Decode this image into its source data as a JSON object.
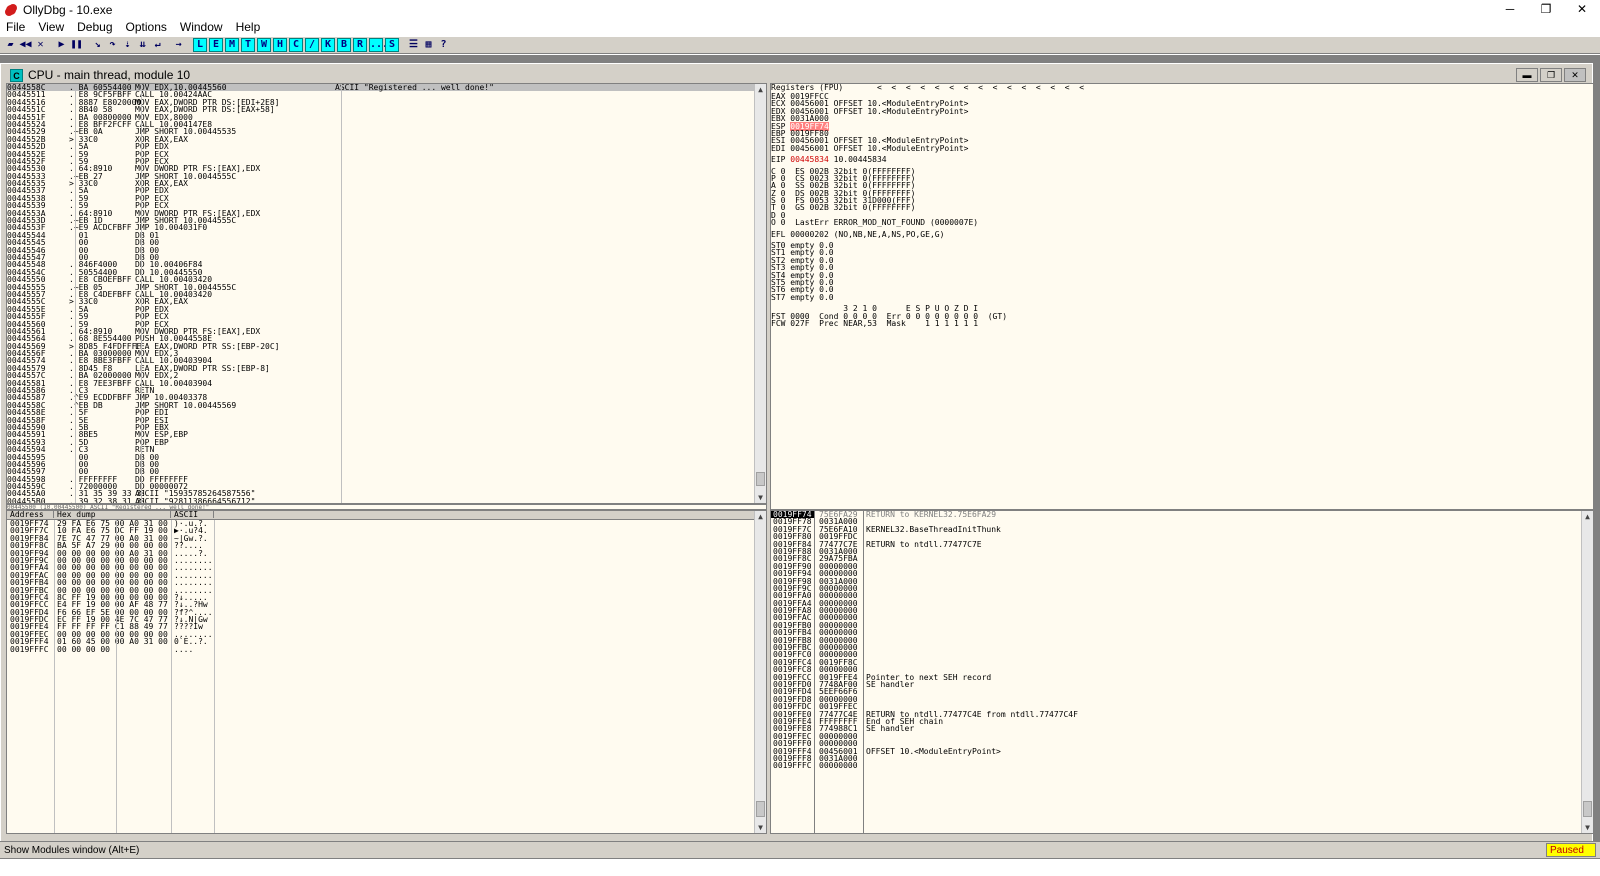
{
  "window": {
    "title": "OllyDbg - 10.exe",
    "min": "─",
    "restore": "❐",
    "close": "✕"
  },
  "menu": [
    "File",
    "View",
    "Debug",
    "Options",
    "Window",
    "Help"
  ],
  "toolbar": {
    "icons": [
      "open-icon",
      "restart-icon",
      "close-debug-icon",
      "run-icon",
      "pause-icon",
      "step-into-icon",
      "step-over-icon",
      "trace-into-icon",
      "trace-over-icon",
      "execute-till-return-icon",
      "goto-icon"
    ],
    "letters": [
      "L",
      "E",
      "M",
      "T",
      "W",
      "H",
      "C",
      "/",
      "K",
      "B",
      "R",
      "...",
      "S"
    ],
    "tail_icons": [
      "list-icon",
      "grid-icon",
      "help-icon"
    ]
  },
  "cpu_window": {
    "title": "CPU - main thread, module 10",
    "icon": "C"
  },
  "disasm": {
    "rows": [
      [
        "0044558C",
        ". BA 60554400",
        "MOV EDX,10.00445560",
        "ASCII \"Registered ... well done!\""
      ],
      [
        "00445511",
        ". E8 9CF5FBFF",
        "CALL 10.00424AAC",
        ""
      ],
      [
        "00445516",
        ". 8887 E8020000",
        "MOV EAX,DWORD PTR DS:[EDI+2E8]",
        ""
      ],
      [
        "0044551C",
        ". 8B40 58",
        "MOV EAX,DWORD PTR DS:[EAX+58]",
        ""
      ],
      [
        "0044551F",
        ". BA 00800000",
        "MOV EDX,8000",
        ""
      ],
      [
        "00445524",
        ". E8 BFF2FCFF",
        "CALL 10.004147E8",
        ""
      ],
      [
        "00445529",
        ".~EB 0A",
        "JMP SHORT 10.00445535",
        ""
      ],
      [
        "0044552B",
        "> 33C0",
        "XOR EAX,EAX",
        ""
      ],
      [
        "0044552D",
        ". 5A",
        "POP EDX",
        ""
      ],
      [
        "0044552E",
        ". 59",
        "POP ECX",
        ""
      ],
      [
        "0044552F",
        ". 59",
        "POP ECX",
        ""
      ],
      [
        "00445530",
        ". 64:8910",
        "MOV DWORD PTR FS:[EAX],EDX",
        ""
      ],
      [
        "00445533",
        ".~EB 27",
        "JMP SHORT 10.0044555C",
        ""
      ],
      [
        "00445535",
        "> 33C0",
        "XOR EAX,EAX",
        ""
      ],
      [
        "00445537",
        ". 5A",
        "POP EDX",
        ""
      ],
      [
        "00445538",
        ". 59",
        "POP ECX",
        ""
      ],
      [
        "00445539",
        ". 59",
        "POP ECX",
        ""
      ],
      [
        "0044553A",
        ". 64:8910",
        "MOV DWORD PTR FS:[EAX],EDX",
        ""
      ],
      [
        "0044553D",
        ".~EB 1D",
        "JMP SHORT 10.0044555C",
        ""
      ],
      [
        "0044553F",
        ".~E9 ACDCFBFF",
        "JMP 10.004031F0",
        ""
      ],
      [
        "00445544",
        "  01",
        "DB 01",
        ""
      ],
      [
        "00445545",
        "  00",
        "DB 00",
        ""
      ],
      [
        "00445546",
        "  00",
        "DB 00",
        ""
      ],
      [
        "00445547",
        "  00",
        "DB 00",
        ""
      ],
      [
        "00445548",
        ". 846F4000",
        "DD 10.00406F84",
        ""
      ],
      [
        "0044554C",
        ". 50554400",
        "DD 10.00445550",
        ""
      ],
      [
        "00445550",
        ". E8 CBOEFBFF",
        "CALL 10.00403420",
        ""
      ],
      [
        "00445555",
        ".~EB 05",
        "JMP SHORT 10.0044555C",
        ""
      ],
      [
        "00445557",
        ". E8 C4DEFBFF",
        "CALL 10.00403420",
        ""
      ],
      [
        "0044555C",
        "> 33C0",
        "XOR EAX,EAX",
        ""
      ],
      [
        "0044555E",
        ". 5A",
        "POP EDX",
        ""
      ],
      [
        "0044555F",
        ". 59",
        "POP ECX",
        ""
      ],
      [
        "00445560",
        ". 59",
        "POP ECX",
        ""
      ],
      [
        "00445561",
        ". 64:8910",
        "MOV DWORD PTR FS:[EAX],EDX",
        ""
      ],
      [
        "00445564",
        ". 68 8E554400",
        "PUSH 10.0044558E",
        ""
      ],
      [
        "00445569",
        "> 8D85 F4FDFFFF",
        "LEA EAX,DWORD PTR SS:[EBP-20C]",
        ""
      ],
      [
        "0044556F",
        ". BA 03000000",
        "MOV EDX,3",
        ""
      ],
      [
        "00445574",
        ". E8 8BE3FBFF",
        "CALL 10.00403904",
        ""
      ],
      [
        "00445579",
        ". 8D45 F8",
        "LEA EAX,DWORD PTR SS:[EBP-8]",
        ""
      ],
      [
        "0044557C",
        ". BA 02000000",
        "MOV EDX,2",
        ""
      ],
      [
        "00445581",
        ". E8 7EE3FBFF",
        "CALL 10.00403904",
        ""
      ],
      [
        "00445586",
        ". C3",
        "RETN",
        ""
      ],
      [
        "00445587",
        ".^E9 ECDDFBFF",
        "JMP 10.00403378",
        ""
      ],
      [
        "0044558C",
        ".^EB DB",
        "JMP SHORT 10.00445569",
        ""
      ],
      [
        "0044558E",
        ". 5F",
        "POP EDI",
        ""
      ],
      [
        "0044558F",
        ". 5E",
        "POP ESI",
        ""
      ],
      [
        "00445590",
        ". 5B",
        "POP EBX",
        ""
      ],
      [
        "00445591",
        ". 8BE5",
        "MOV ESP,EBP",
        ""
      ],
      [
        "00445593",
        ". 5D",
        "POP EBP",
        ""
      ],
      [
        "00445594",
        ". C3",
        "RETN",
        ""
      ],
      [
        "00445595",
        "  00",
        "DB 00",
        ""
      ],
      [
        "00445596",
        "  00",
        "DB 00",
        ""
      ],
      [
        "00445597",
        "  00",
        "DB 00",
        ""
      ],
      [
        "00445598",
        ". FFFFFFFF",
        "DD FFFFFFFF",
        ""
      ],
      [
        "0044559C",
        ". 72000000",
        "DD 00000072",
        ""
      ],
      [
        "004455A0",
        ". 31 35 39 33 3!",
        "ASCII \"15935785264587556\"",
        ""
      ],
      [
        "004455B0",
        ". 39 32 38 31 3!",
        "ASCII \"92811386664556712\"",
        ""
      ]
    ]
  },
  "infoline": "00445500 (10.00445500) ASCII \"Registered ... well done!\"",
  "registers": {
    "header": "Registers (FPU)",
    "arrows": "<  <  <  <  <  <  <  <  <  <  <  <  <  <  <",
    "general": [
      [
        "EAX",
        "0019FFCC",
        ""
      ],
      [
        "ECX",
        "00456001",
        "OFFSET 10.<ModuleEntryPoint>"
      ],
      [
        "EDX",
        "00456001",
        "OFFSET 10.<ModuleEntryPoint>"
      ],
      [
        "EBX",
        "0031A000",
        ""
      ],
      [
        "ESP",
        "0019FF74",
        ""
      ],
      [
        "EBP",
        "0019FF80",
        ""
      ],
      [
        "ESI",
        "00456001",
        "OFFSET 10.<ModuleEntryPoint>"
      ],
      [
        "EDI",
        "00456001",
        "OFFSET 10.<ModuleEntryPoint>"
      ]
    ],
    "eip": [
      "EIP",
      "00445834",
      "10.00445834"
    ],
    "flags": [
      "C 0  ES 002B 32bit 0(FFFFFFFF)",
      "P 0  CS 0023 32bit 0(FFFFFFFF)",
      "A 0  SS 002B 32bit 0(FFFFFFFF)",
      "Z 0  DS 002B 32bit 0(FFFFFFFF)",
      "S 0  FS 0053 32bit 31D000(FFF)",
      "T 0  GS 002B 32bit 0(FFFFFFFF)",
      "D 0",
      "O 0  LastErr ERROR_MOD_NOT_FOUND (0000007E)"
    ],
    "efl": "EFL 00000202 (NO,NB,NE,A,NS,PO,GE,G)",
    "fpu": [
      "ST0 empty 0.0",
      "ST1 empty 0.0",
      "ST2 empty 0.0",
      "ST3 empty 0.0",
      "ST4 empty 0.0",
      "ST5 empty 0.0",
      "ST6 empty 0.0",
      "ST7 empty 0.0"
    ],
    "fpu_footer": [
      "               3 2 1 0      E S P U O Z D I",
      "FST 0000  Cond 0 0 0 0  Err 0 0 0 0 0 0 0 0  (GT)",
      "FCW 027F  Prec NEAR,53  Mask    1 1 1 1 1 1"
    ]
  },
  "dump": {
    "headers": [
      "Address",
      "Hex dump",
      "ASCII"
    ],
    "rows": [
      [
        "0019FF74",
        "29 FA E6 75 00 A0 31 00",
        ")·.u.?."
      ],
      [
        "0019FF7C",
        "10 FA E6 75 DC FF 19 00",
        "▶·.u?4."
      ],
      [
        "0019FF84",
        "7E 7C 47 77 00 A0 31 00",
        "~|Gw.?."
      ],
      [
        "0019FF8C",
        "BA 5F A7 29 00 00 00 00",
        "??...."
      ],
      [
        "0019FF94",
        "00 00 00 00 00 A0 31 00",
        ".....?."
      ],
      [
        "0019FF9C",
        "00 00 00 00 00 00 00 00",
        "........"
      ],
      [
        "0019FFA4",
        "00 00 00 00 00 00 00 00",
        "........"
      ],
      [
        "0019FFAC",
        "00 00 00 00 00 00 00 00",
        "........"
      ],
      [
        "0019FFB4",
        "00 00 00 00 00 00 00 00",
        "........"
      ],
      [
        "0019FFBC",
        "00 00 00 00 00 00 00 00",
        "........"
      ],
      [
        "0019FFC4",
        "8C FF 19 00 00 00 00 00",
        "?↓....."
      ],
      [
        "0019FFCC",
        "E4 FF 19 00 00 AF 48 77",
        "?↓..?Hw"
      ],
      [
        "0019FFD4",
        "F6 66 EF 5E 00 00 00 00",
        "?f?^...."
      ],
      [
        "0019FFDC",
        "EC FF 19 00 4E 7C 47 77",
        "?↓.N|Gw"
      ],
      [
        "0019FFE4",
        "FF FF FF FF C1 88 49 77",
        "????Iw"
      ],
      [
        "0019FFEC",
        "00 00 00 00 00 00 00 00",
        "........"
      ],
      [
        "0019FFF4",
        "01 60 45 00 00 A0 31 00",
        "0`E..?."
      ],
      [
        "0019FFFC",
        "00 00 00 00",
        "...."
      ]
    ]
  },
  "stack": {
    "rows": [
      [
        "0019FF74",
        "75E6FA29",
        "RETURN to KERNEL32.75E6FA29",
        "sel"
      ],
      [
        "0019FF78",
        "0031A000",
        "",
        ""
      ],
      [
        "0019FF7C",
        "75E6FA10",
        "KERNEL32.BaseThreadInitThunk",
        ""
      ],
      [
        "0019FF80",
        "0019FFDC",
        "",
        ""
      ],
      [
        "0019FF84",
        "77477C7E",
        "RETURN to ntdll.77477C7E",
        ""
      ],
      [
        "0019FF88",
        "0031A000",
        "",
        ""
      ],
      [
        "0019FF8C",
        "29A75FBA",
        "",
        ""
      ],
      [
        "0019FF90",
        "00000000",
        "",
        ""
      ],
      [
        "0019FF94",
        "00000000",
        "",
        ""
      ],
      [
        "0019FF98",
        "0031A000",
        "",
        ""
      ],
      [
        "0019FF9C",
        "00000000",
        "",
        ""
      ],
      [
        "0019FFA0",
        "00000000",
        "",
        ""
      ],
      [
        "0019FFA4",
        "00000000",
        "",
        ""
      ],
      [
        "0019FFA8",
        "00000000",
        "",
        ""
      ],
      [
        "0019FFAC",
        "00000000",
        "",
        ""
      ],
      [
        "0019FFB0",
        "00000000",
        "",
        ""
      ],
      [
        "0019FFB4",
        "00000000",
        "",
        ""
      ],
      [
        "0019FFB8",
        "00000000",
        "",
        ""
      ],
      [
        "0019FFBC",
        "00000000",
        "",
        ""
      ],
      [
        "0019FFC0",
        "00000000",
        "",
        ""
      ],
      [
        "0019FFC4",
        "0019FF8C",
        "",
        ""
      ],
      [
        "0019FFC8",
        "00000000",
        "",
        ""
      ],
      [
        "0019FFCC",
        "0019FFE4",
        "Pointer to next SEH record",
        ""
      ],
      [
        "0019FFD0",
        "7748AF00",
        "SE handler",
        ""
      ],
      [
        "0019FFD4",
        "5EEF66F6",
        "",
        ""
      ],
      [
        "0019FFD8",
        "00000000",
        "",
        ""
      ],
      [
        "0019FFDC",
        "0019FFEC",
        "",
        ""
      ],
      [
        "0019FFE0",
        "77477C4E",
        "RETURN to ntdll.77477C4E from ntdll.77477C4F",
        ""
      ],
      [
        "0019FFE4",
        "FFFFFFFF",
        "End of SEH chain",
        ""
      ],
      [
        "0019FFE8",
        "774988C1",
        "SE handler",
        ""
      ],
      [
        "0019FFEC",
        "00000000",
        "",
        ""
      ],
      [
        "0019FFF0",
        "00000000",
        "",
        ""
      ],
      [
        "0019FFF4",
        "00456001",
        "OFFSET 10.<ModuleEntryPoint>",
        ""
      ],
      [
        "0019FFF8",
        "0031A000",
        "",
        ""
      ],
      [
        "0019FFFC",
        "00000000",
        "",
        ""
      ]
    ]
  },
  "status": {
    "text": "Show Modules window (Alt+E)",
    "state": "Paused"
  }
}
